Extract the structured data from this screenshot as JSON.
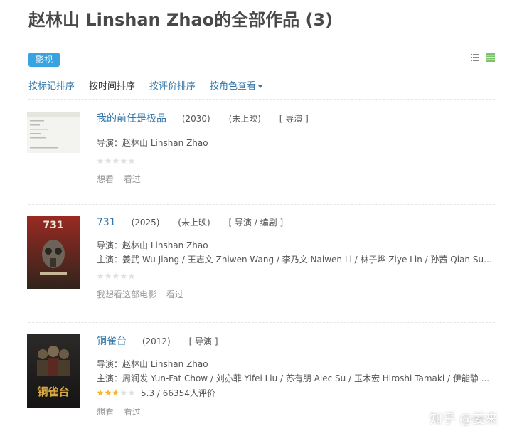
{
  "page": {
    "title": "赵林山 Linshan Zhao的全部作品 (3)"
  },
  "type_tag": "影视",
  "sort_options": {
    "by_mark": "按标记排序",
    "by_time": "按时间排序",
    "by_rating": "按评价排序",
    "by_role": "按角色查看"
  },
  "works": [
    {
      "title": "我的前任是极品",
      "year": "(2030)",
      "status": "(未上映)",
      "role": "[ 导演 ]",
      "director": "导演：赵林山 Linshan Zhao",
      "cast": "",
      "rating_fraction": 0,
      "rating_text": "",
      "action_want": "想看",
      "action_seen": "看过",
      "poster_colors": [
        "#f4f4f0",
        "#dcdcd4"
      ]
    },
    {
      "title": "731",
      "year": "(2025)",
      "status": "(未上映)",
      "role": "[ 导演 / 编剧 ]",
      "director": "导演：赵林山 Linshan Zhao",
      "cast": "主演：姜武 Wu Jiang / 王志文 Zhiwen Wang / 李乃文 Naiwen Li / 林子烨 Ziye Lin / 孙茜 Qian Sun...",
      "rating_fraction": 0,
      "rating_text": "",
      "action_want": "我想看这部电影",
      "action_seen": "看过",
      "poster_colors": [
        "#8a1f1a",
        "#3a2a20"
      ]
    },
    {
      "title": "铜雀台",
      "year": "(2012)",
      "status": "",
      "role": "[ 导演 ]",
      "director": "导演：赵林山 Linshan Zhao",
      "cast": "主演：周润发 Yun-Fat Chow / 刘亦菲 Yifei Liu / 苏有朋 Alec Su / 玉木宏 Hiroshi Tamaki / 伊能静 ...",
      "rating_fraction": 0.53,
      "rating_text": "5.3 / 66354人评价",
      "action_want": "想看",
      "action_seen": "看过",
      "poster_colors": [
        "#1c1a18",
        "#8a6a30"
      ]
    }
  ],
  "watermark": "知乎 @姜来",
  "colors": {
    "link": "#3377aa",
    "tag": "#37a3e0",
    "star_on": "#f5b52e",
    "star_off": "#e0e0e0",
    "list_view_active": "#7dc36b"
  }
}
